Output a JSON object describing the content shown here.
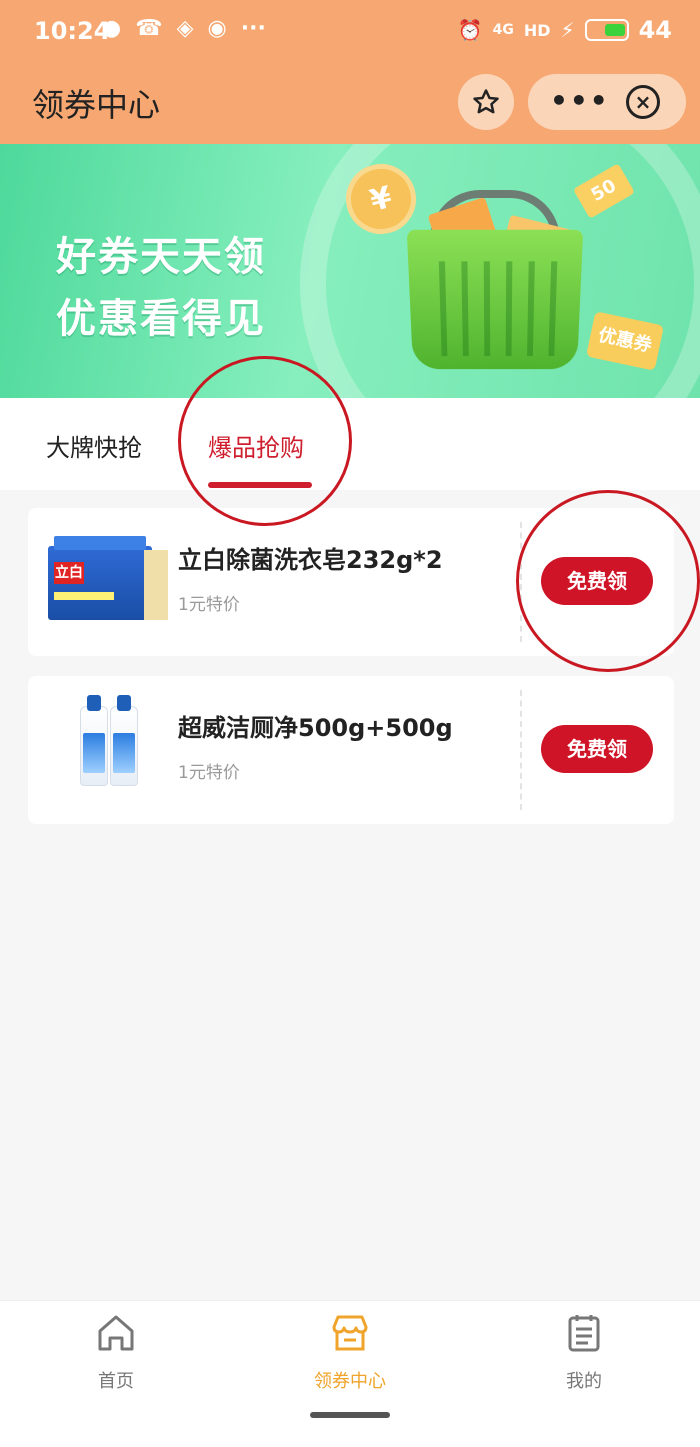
{
  "status_bar": {
    "time": "10:24",
    "network": "4G",
    "hd": "HD",
    "battery": "44"
  },
  "header": {
    "title": "领券中心"
  },
  "banner": {
    "line1": "好券天天领",
    "line2": "优惠看得见",
    "coin": "¥",
    "tag_50": "50",
    "tag_coupon": "优惠券"
  },
  "tabs": [
    {
      "label": "大牌快抢",
      "active": false
    },
    {
      "label": "爆品抢购",
      "active": true
    }
  ],
  "products": [
    {
      "name": "立白除菌洗衣皂232g*2",
      "subtitle": "1元特价",
      "button": "免费领",
      "thumb_logo": "立白"
    },
    {
      "name": "超威洁厕净500g+500g",
      "subtitle": "1元特价",
      "button": "免费领"
    }
  ],
  "bottom_nav": [
    {
      "label": "首页",
      "icon": "home-icon",
      "active": false
    },
    {
      "label": "领券中心",
      "icon": "store-icon",
      "active": true
    },
    {
      "label": "我的",
      "icon": "clipboard-icon",
      "active": false
    }
  ],
  "colors": {
    "header_bg": "#f7a872",
    "accent_red": "#cf1427",
    "active_nav": "#f0a42b"
  }
}
